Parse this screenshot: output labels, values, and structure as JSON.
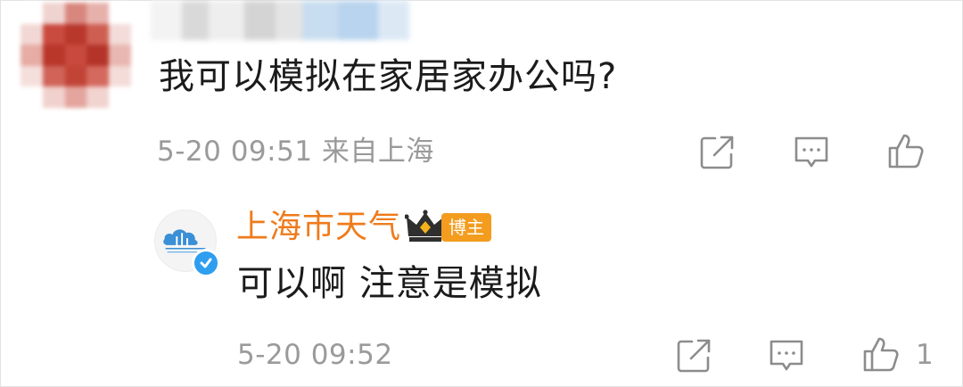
{
  "comment": {
    "text": "我可以模拟在家居家办公吗?",
    "timestamp": "5-20 09:51",
    "location": "来自上海",
    "meta_line": "5-20 09:51 来自上海",
    "icons": [
      "share-icon",
      "comment-icon",
      "like-icon"
    ]
  },
  "reply": {
    "author": "上海市天气",
    "badge": "博主",
    "text": "可以啊 注意是模拟",
    "timestamp": "5-20 09:52",
    "like_count": "1",
    "icons": [
      "share-icon",
      "comment-icon",
      "like-icon"
    ]
  },
  "colors": {
    "author_orange": "#ef7b1c",
    "badge_orange": "#f39c1e",
    "meta_gray": "#9a9a9a",
    "verified_blue": "#2f9ef0"
  }
}
